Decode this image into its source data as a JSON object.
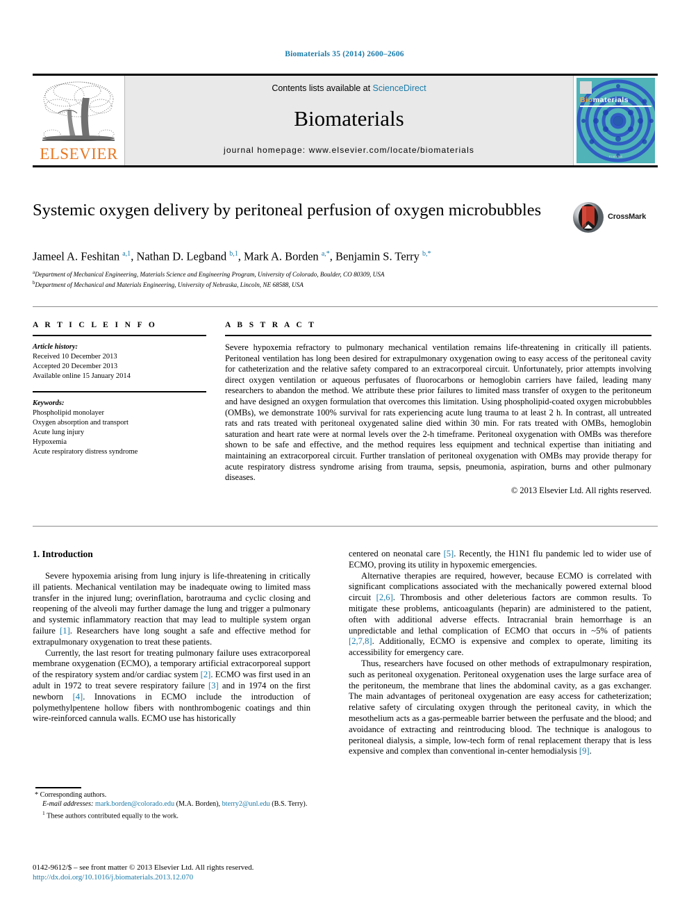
{
  "running_head": "Biomaterials 35 (2014) 2600–2606",
  "header": {
    "contents_prefix": "Contents lists available at ",
    "sciencedirect": "ScienceDirect",
    "journal_name": "Biomaterials",
    "homepage": "journal homepage: www.elsevier.com/locate/biomaterials",
    "publisher_logo_text": "ELSEVIER",
    "cover": {
      "title_part1": "Bio",
      "title_part2": "materials",
      "footer_text": "ELSEVIER"
    }
  },
  "article": {
    "title": "Systemic oxygen delivery by peritoneal perfusion of oxygen microbubbles",
    "crossmark_label": "CrossMark",
    "authors_html": "Jameel A. Feshitan <sup>a,1</sup>, Nathan D. Legband <sup>b,1</sup>, Mark A. Borden <sup>a,*</sup>, Benjamin S. Terry <sup>b,*</sup>",
    "affiliations": [
      "Department of Mechanical Engineering, Materials Science and Engineering Program, University of Colorado, Boulder, CO 80309, USA",
      "Department of Mechanical and Materials Engineering, University of Nebraska, Lincoln, NE 68588, USA"
    ],
    "affiliation_marks": [
      "a",
      "b"
    ]
  },
  "article_info": {
    "heading": "A R T I C L E   I N F O",
    "history_label": "Article history:",
    "history": [
      "Received 10 December 2013",
      "Accepted 20 December 2013",
      "Available online 15 January 2014"
    ],
    "keywords_label": "Keywords:",
    "keywords": [
      "Phospholipid monolayer",
      "Oxygen absorption and transport",
      "Acute lung injury",
      "Hypoxemia",
      "Acute respiratory distress syndrome"
    ]
  },
  "abstract": {
    "heading": "A B S T R A C T",
    "text": "Severe hypoxemia refractory to pulmonary mechanical ventilation remains life-threatening in critically ill patients. Peritoneal ventilation has long been desired for extrapulmonary oxygenation owing to easy access of the peritoneal cavity for catheterization and the relative safety compared to an extracorporeal circuit. Unfortunately, prior attempts involving direct oxygen ventilation or aqueous perfusates of fluorocarbons or hemoglobin carriers have failed, leading many researchers to abandon the method. We attribute these prior failures to limited mass transfer of oxygen to the peritoneum and have designed an oxygen formulation that overcomes this limitation. Using phospholipid-coated oxygen microbubbles (OMBs), we demonstrate 100% survival for rats experiencing acute lung trauma to at least 2 h. In contrast, all untreated rats and rats treated with peritoneal oxygenated saline died within 30 min. For rats treated with OMBs, hemoglobin saturation and heart rate were at normal levels over the 2-h timeframe. Peritoneal oxygenation with OMBs was therefore shown to be safe and effective, and the method requires less equipment and technical expertise than initiating and maintaining an extracorporeal circuit. Further translation of peritoneal oxygenation with OMBs may provide therapy for acute respiratory distress syndrome arising from trauma, sepsis, pneumonia, aspiration, burns and other pulmonary diseases.",
    "copyright": "© 2013 Elsevier Ltd. All rights reserved."
  },
  "body": {
    "section_heading": "1. Introduction",
    "left_paragraphs": [
      {
        "parts": [
          {
            "t": "Severe hypoxemia arising from lung injury is life-threatening in critically ill patients. Mechanical ventilation may be inadequate owing to limited mass transfer in the injured lung; overinflation, barotrauma and cyclic closing and reopening of the alveoli may further damage the lung and trigger a pulmonary and systemic inflammatory reaction that may lead to multiple system organ failure "
          },
          {
            "t": "[1]",
            "ref": true
          },
          {
            "t": ". Researchers have long sought a safe and effective method for extrapulmonary oxygenation to treat these patients."
          }
        ]
      },
      {
        "parts": [
          {
            "t": "Currently, the last resort for treating pulmonary failure uses extracorporeal membrane oxygenation (ECMO), a temporary artificial extracorporeal support of the respiratory system and/or cardiac system "
          },
          {
            "t": "[2]",
            "ref": true
          },
          {
            "t": ". ECMO was first used in an adult in 1972 to treat severe respiratory failure "
          },
          {
            "t": "[3]",
            "ref": true
          },
          {
            "t": " and in 1974 on the first newborn "
          },
          {
            "t": "[4]",
            "ref": true
          },
          {
            "t": ". Innovations in ECMO include the introduction of polymethylpentene hollow fibers with nonthrombogenic coatings and thin wire-reinforced cannula walls. ECMO use has historically"
          }
        ]
      }
    ],
    "right_paragraphs": [
      {
        "first": true,
        "parts": [
          {
            "t": "centered on neonatal care "
          },
          {
            "t": "[5]",
            "ref": true
          },
          {
            "t": ". Recently, the H1N1 flu pandemic led to wider use of ECMO, proving its utility in hypoxemic emergencies."
          }
        ]
      },
      {
        "parts": [
          {
            "t": "Alternative therapies are required, however, because ECMO is correlated with significant complications associated with the mechanically powered external blood circuit "
          },
          {
            "t": "[2,6]",
            "ref": true
          },
          {
            "t": ". Thrombosis and other deleterious factors are common results. To mitigate these problems, anticoagulants (heparin) are administered to the patient, often with additional adverse effects. Intracranial brain hemorrhage is an unpredictable and lethal complication of ECMO that occurs in ~5% of patients "
          },
          {
            "t": "[2,7,8]",
            "ref": true
          },
          {
            "t": ". Additionally, ECMO is expensive and complex to operate, limiting its accessibility for emergency care."
          }
        ]
      },
      {
        "parts": [
          {
            "t": "Thus, researchers have focused on other methods of extrapulmonary respiration, such as peritoneal oxygenation. Peritoneal oxygenation uses the large surface area of the peritoneum, the membrane that lines the abdominal cavity, as a gas exchanger. The main advantages of peritoneal oxygenation are easy access for catheterization; relative safety of circulating oxygen through the peritoneal cavity, in which the mesothelium acts as a gas-permeable barrier between the perfusate and the blood; and avoidance of extracting and reintroducing blood. The technique is analogous to peritoneal dialysis, a simple, low-tech form of renal replacement therapy that is less expensive and complex than conventional in-center hemodialysis "
          },
          {
            "t": "[9]",
            "ref": true
          },
          {
            "t": "."
          }
        ]
      }
    ]
  },
  "footnotes": {
    "corresponding": "* Corresponding authors.",
    "email_label": "E-mail addresses:",
    "email_1": "mark.borden@colorado.edu",
    "email_1_owner": "(M.A. Borden),",
    "email_2": "bterry2@unl.edu",
    "email_2_owner": "(B.S. Terry).",
    "equal_marker": "1",
    "equal_contrib": "These authors contributed equally to the work."
  },
  "imprint": {
    "issn_line": "0142-9612/$ – see front matter © 2013 Elsevier Ltd. All rights reserved.",
    "doi": "http://dx.doi.org/10.1016/j.biomaterials.2013.12.070"
  },
  "colors": {
    "link": "#1a7aa8",
    "elsevier_orange": "#E87722",
    "cover_teal": "#4fb3b8"
  }
}
